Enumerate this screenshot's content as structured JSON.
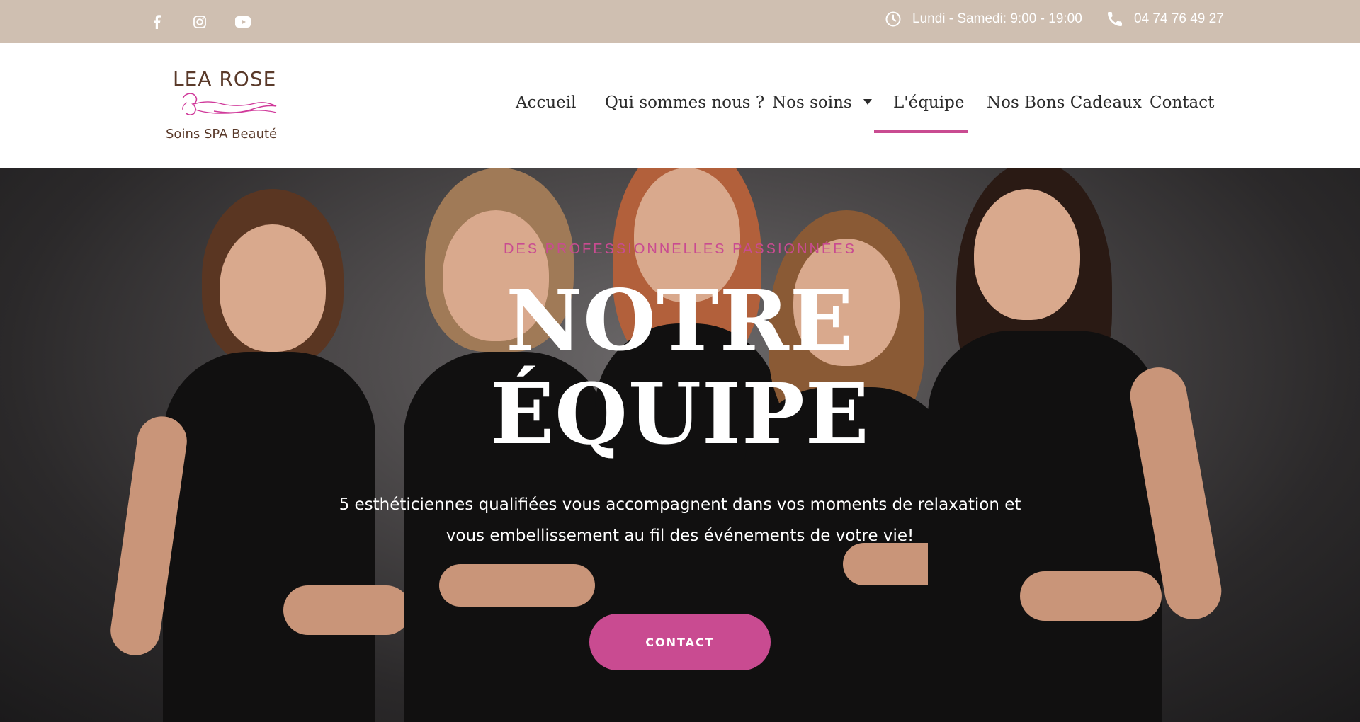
{
  "topbar": {
    "social": [
      {
        "icon": "facebook-icon"
      },
      {
        "icon": "instagram-icon"
      },
      {
        "icon": "youtube-icon"
      }
    ],
    "hours": "Lundi - Samedi: 9:00 - 19:00",
    "phone": "04 74 76 49 27",
    "bg_color": "#cfbfb1"
  },
  "logo": {
    "title": "LEA ROSE",
    "subtitle": "Soins SPA Beauté"
  },
  "nav": {
    "items": [
      {
        "label": "Accueil"
      },
      {
        "label": "Qui sommes nous ?"
      },
      {
        "label": "Nos soins"
      },
      {
        "label": "L'équipe"
      },
      {
        "label": "Nos Bons Cadeaux"
      },
      {
        "label": "Contact"
      }
    ],
    "active_index": 3,
    "accent_color": "#c94b91"
  },
  "hero": {
    "kicker": "DES PROFESSIONNELLES PASSIONNÉES",
    "title_line1": "NOTRE",
    "title_line2": "ÉQUIPE",
    "description": "5 esthéticiennes qualifiées vous accompagnent dans vos moments de relaxation et vous embellissement au fil des événements de votre vie!",
    "cta_label": "CONTACT"
  }
}
